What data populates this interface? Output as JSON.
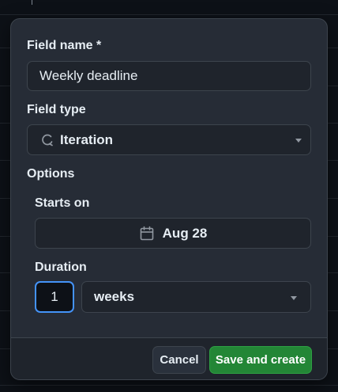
{
  "form": {
    "field_name_label": "Field name *",
    "field_name_value": "Weekly deadline",
    "field_type_label": "Field type",
    "field_type_value": "Iteration",
    "options_label": "Options",
    "starts_on_label": "Starts on",
    "starts_on_value": "Aug 28",
    "duration_label": "Duration",
    "duration_value": "1",
    "duration_unit": "weeks"
  },
  "footer": {
    "cancel_label": "Cancel",
    "save_label": "Save and create"
  },
  "icons": {
    "iteration": "iteration-icon",
    "calendar": "calendar-icon",
    "dropdown": "chevron-down-icon"
  },
  "colors": {
    "panel_bg": "#262c36",
    "page_bg": "#0d1117",
    "primary_green": "#238636",
    "focus_blue": "#4493f8"
  }
}
